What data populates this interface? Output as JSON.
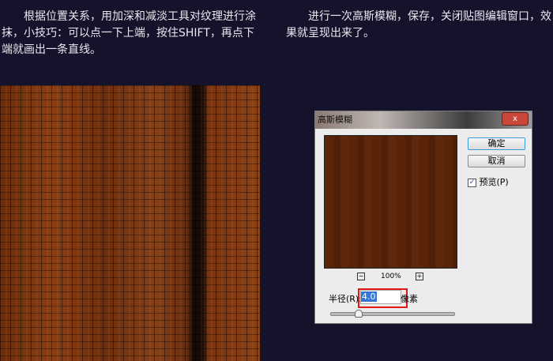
{
  "instructions": {
    "left": "根据位置关系，用加深和减淡工具对纹理进行涂抹，小技巧：可以点一下上端，按住SHIFT，再点下端就画出一条直线。",
    "right": "进行一次高斯模糊，保存，关闭贴图编辑窗口，效果就呈现出来了。"
  },
  "dialog": {
    "title": "高斯模糊",
    "close": "x",
    "ok": "确定",
    "cancel": "取消",
    "preview_label": "预览(P)",
    "preview_checked": true,
    "zoom_out": "−",
    "zoom_level": "100%",
    "zoom_in": "+",
    "radius_label": "半径(R):",
    "radius_value": "4.0",
    "unit": "像素",
    "slider_fraction": 0.2
  }
}
